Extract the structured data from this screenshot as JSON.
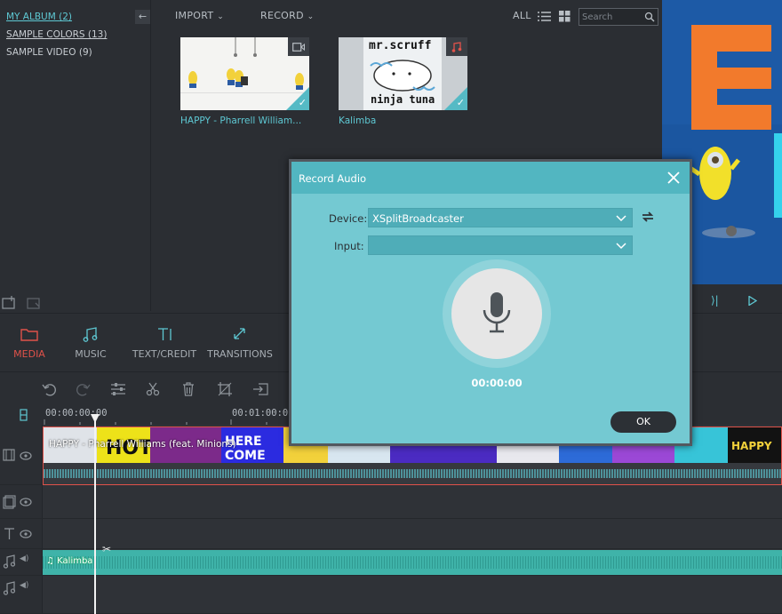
{
  "sidebar": {
    "items": [
      {
        "label": "MY ALBUM (2)"
      },
      {
        "label": "SAMPLE COLORS (13)"
      },
      {
        "label": "SAMPLE VIDEO (9)"
      }
    ],
    "collapse_icon": "arrow-left-icon"
  },
  "toolbar": {
    "import_label": "IMPORT",
    "record_label": "RECORD",
    "filter_label": "ALL",
    "search_placeholder": "Search"
  },
  "media": [
    {
      "caption": "HAPPY - Pharrell William...",
      "type_icon": "video-icon"
    },
    {
      "caption": "Kalimba",
      "type_icon": "music-note-icon",
      "thumb_text_top": "mr.scruff",
      "thumb_text_bottom": "ninja tuna"
    }
  ],
  "tabs": [
    {
      "label": "MEDIA",
      "icon": "folder-icon"
    },
    {
      "label": "MUSIC",
      "icon": "music-icon"
    },
    {
      "label": "TEXT/CREDIT",
      "icon": "text-icon"
    },
    {
      "label": "TRANSITIONS",
      "icon": "transitions-icon"
    }
  ],
  "timeline": {
    "times": [
      "00:00:00:00",
      "00:01:00:00"
    ],
    "video_clip_title": "HAPPY - Pharrell Williams (feat. Minions)",
    "audio_clip_title": "Kalimba"
  },
  "dialog": {
    "title": "Record Audio",
    "device_label": "Device:",
    "device_value": "XSplitBroadcaster",
    "input_label": "Input:",
    "input_value": "",
    "timer": "00:00:00",
    "ok_label": "OK"
  },
  "colors": {
    "accent": "#5ec8d3",
    "active_tab": "#e0524a",
    "dialog_bg": "#74c9d2",
    "dialog_title_bg": "#52b6c1",
    "audio_wave": "#3fb3a9"
  }
}
